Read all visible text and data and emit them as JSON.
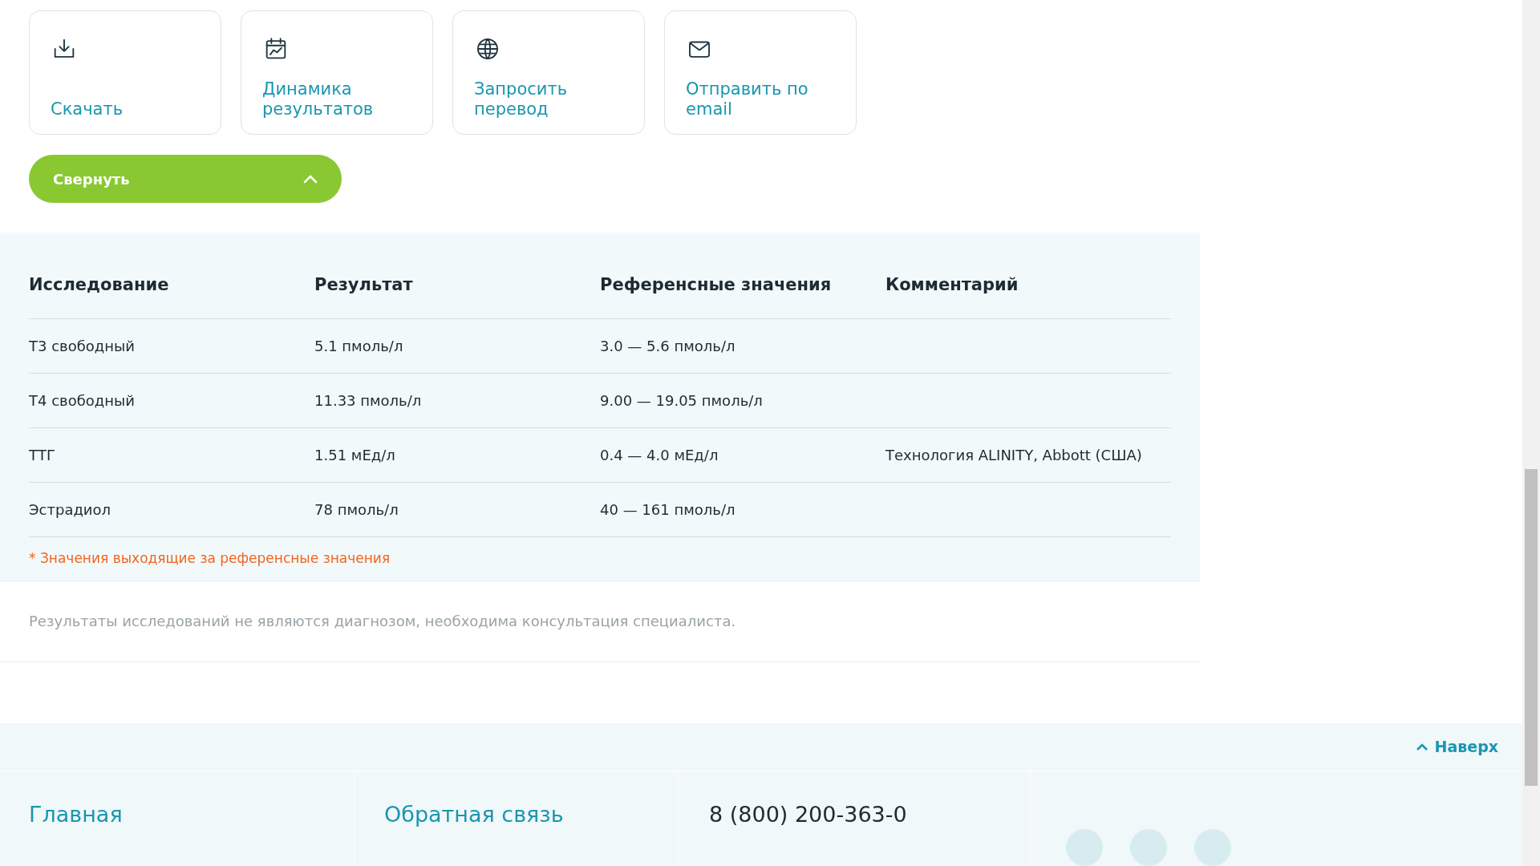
{
  "actions": [
    {
      "kind": "download",
      "label": "Скачать"
    },
    {
      "kind": "chart",
      "label": "Динамика результатов"
    },
    {
      "kind": "globe",
      "label": "Запросить перевод"
    },
    {
      "kind": "mail",
      "label": "Отправить по email"
    }
  ],
  "collapse_button": {
    "label": "Свернуть"
  },
  "table": {
    "columns": [
      "Исследование",
      "Результат",
      "Референсные значения",
      "Комментарий"
    ],
    "rows": [
      [
        "Т3 свободный",
        "5.1 пмоль/л",
        "3.0 — 5.6 пмоль/л",
        ""
      ],
      [
        "Т4 свободный",
        "11.33 пмоль/л",
        "9.00 — 19.05 пмоль/л",
        ""
      ],
      [
        "ТТГ",
        "1.51 мЕд/л",
        "0.4 — 4.0 мЕд/л",
        "Технология ALINITY, Abbott (США)"
      ],
      [
        "Эстрадиол",
        "78 пмоль/л",
        "40 — 161 пмоль/л",
        ""
      ]
    ],
    "footnote": "* Значения выходящие за референсные значения"
  },
  "disclaimer": "Результаты исследований не являются диагнозом, необходима консультация специалиста.",
  "footer": {
    "to_top": "Наверх",
    "links": [
      "Главная",
      "Обратная связь"
    ],
    "phone": "8 (800) 200-363-0"
  }
}
